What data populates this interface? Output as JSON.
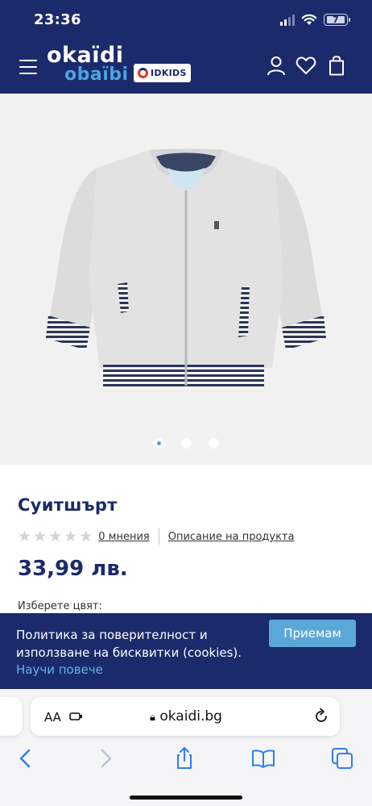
{
  "status_bar": {
    "time": "23:36",
    "battery_level": "7"
  },
  "header": {
    "logo_top": "okaïdi",
    "logo_bottom": "obaïbi",
    "kids_badge": "IDKIDS",
    "icons": [
      "menu-icon",
      "account-icon",
      "heart-icon",
      "bag-icon"
    ]
  },
  "gallery": {
    "slides": 3,
    "active_slide": 1
  },
  "product": {
    "title": "Суитшърт",
    "rating": {
      "stars": 5,
      "filled": 0,
      "reviews_label": "0 мнения"
    },
    "description_link": "Описание на продукта",
    "price": "33,99 лв.",
    "color_label": "Изберете цвят:"
  },
  "cookie_banner": {
    "text": "Политика за поверителност и използване на бисквитки (cookies).",
    "more_link": "Научи повече",
    "accept_label": "Приемам"
  },
  "browser": {
    "text_size_label": "AA",
    "url": "okaidi.bg",
    "toolbar_icons": [
      "back-icon",
      "forward-icon",
      "share-icon",
      "bookmarks-icon",
      "tabs-icon"
    ]
  },
  "colors": {
    "navy": "#1b2a6b",
    "accent_blue": "#5aa8d8",
    "light_blue": "#4aa3df"
  }
}
